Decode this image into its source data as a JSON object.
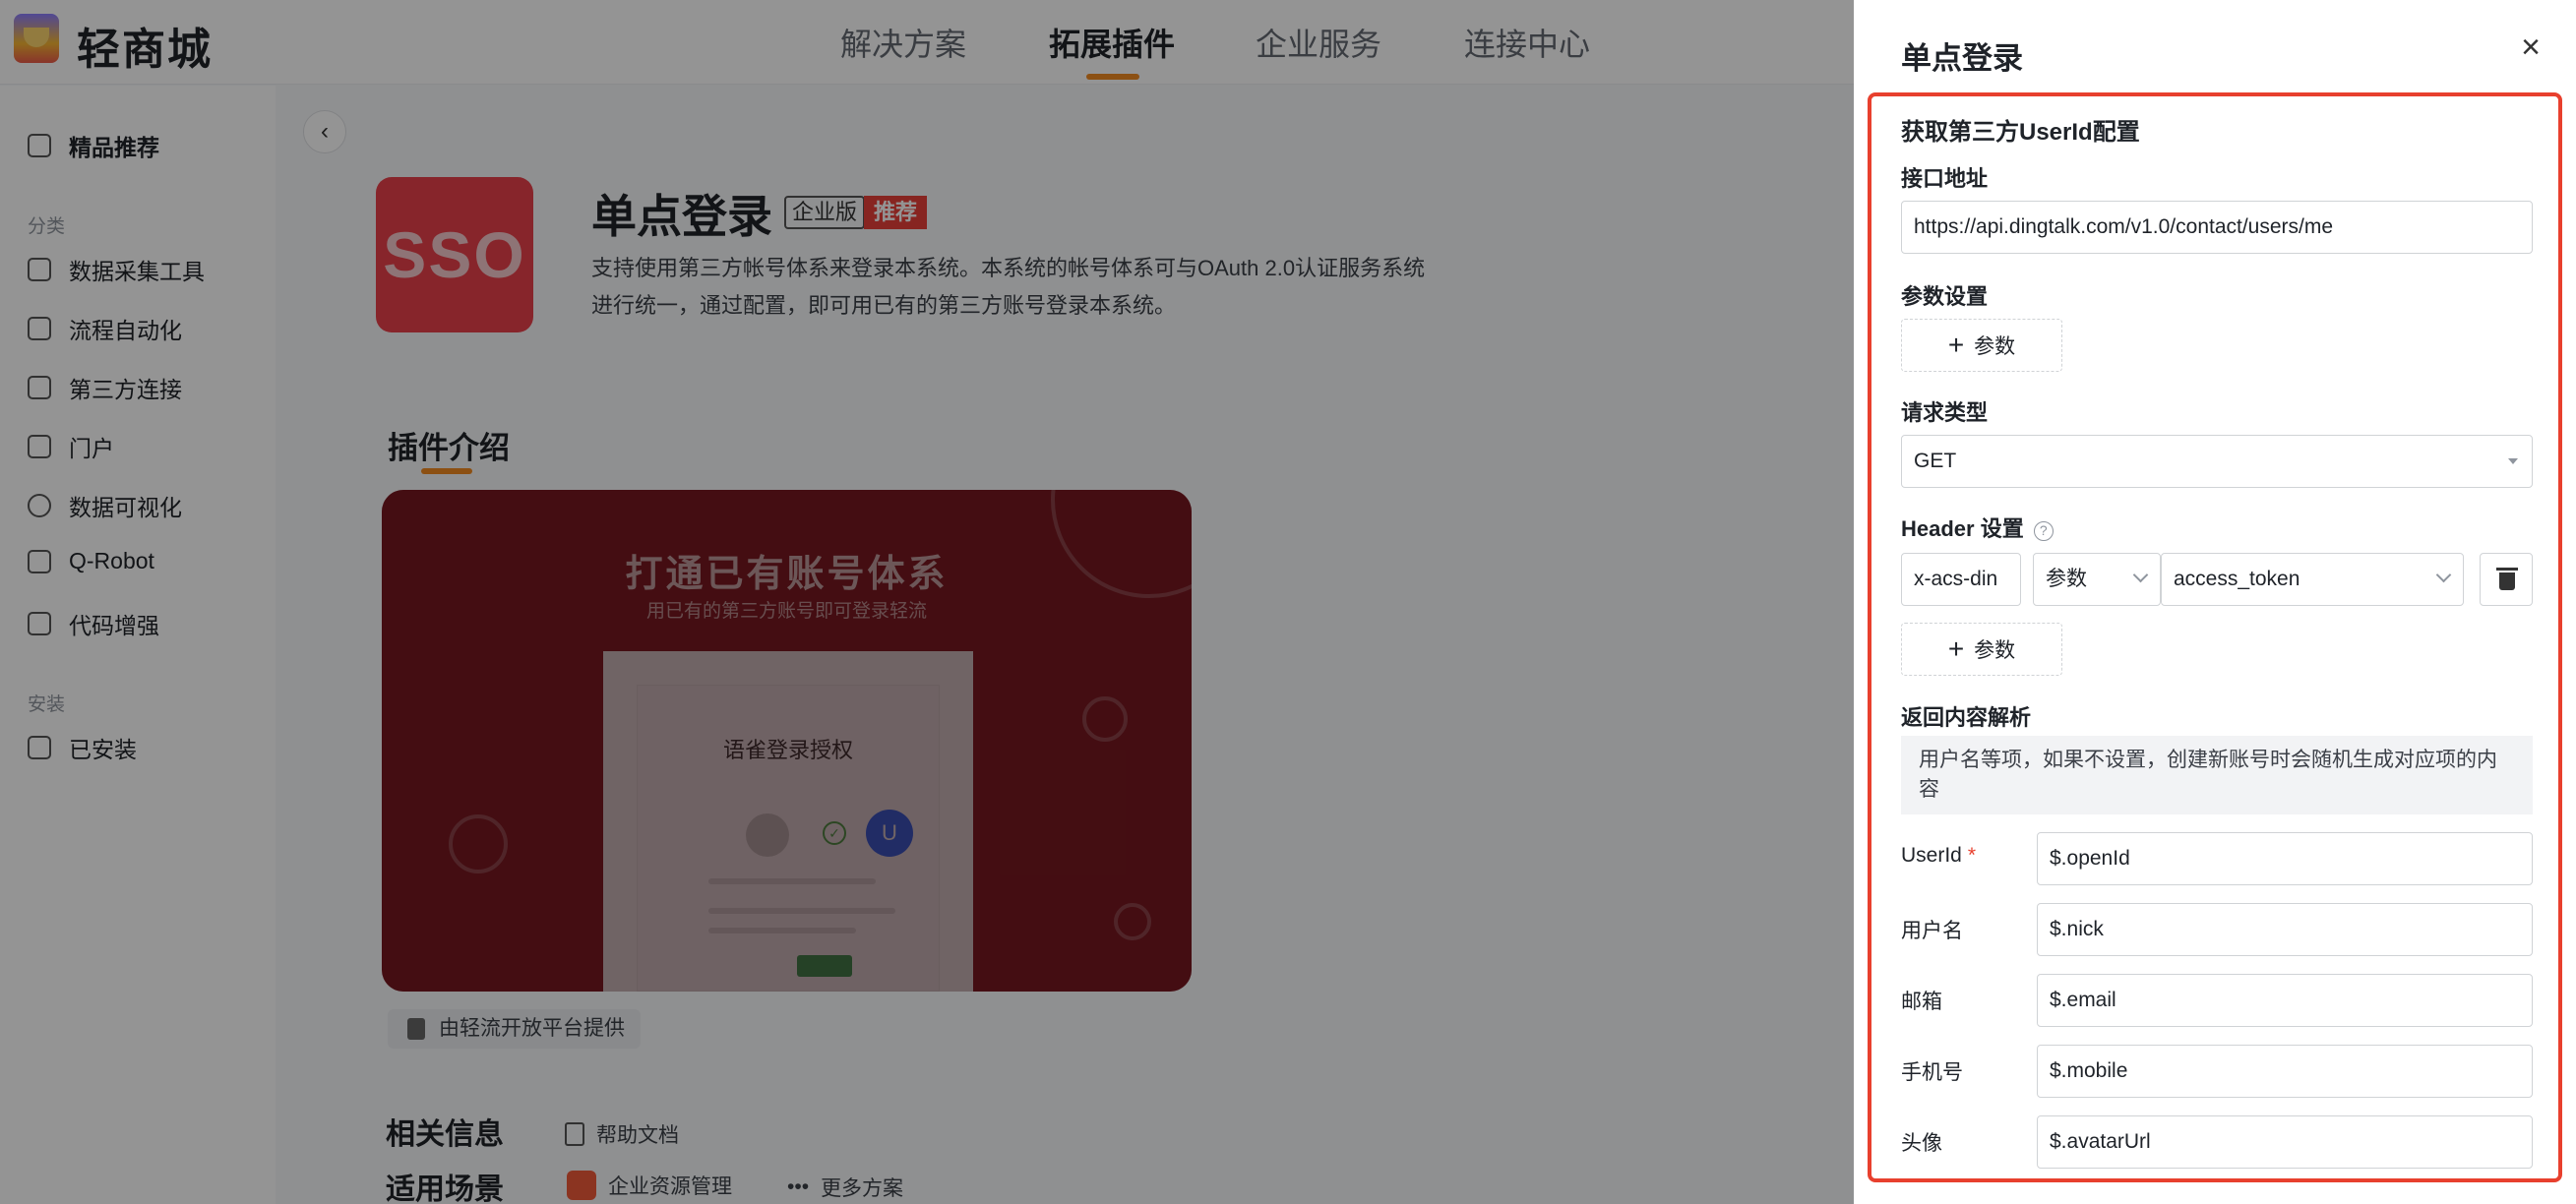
{
  "app": {
    "brand": "轻商城",
    "nav": [
      "解决方案",
      "拓展插件",
      "企业服务",
      "连接中心"
    ],
    "active_nav": "拓展插件"
  },
  "sidebar": {
    "featured": "精品推荐",
    "group_category": "分类",
    "categories": [
      "数据采集工具",
      "流程自动化",
      "第三方连接",
      "门户",
      "数据可视化",
      "Q-Robot",
      "代码增强"
    ],
    "group_install": "安装",
    "installed": "已安装"
  },
  "plugin": {
    "tile_text": "SSO",
    "title": "单点登录",
    "tag_edition": "企业版",
    "tag_recommend": "推荐",
    "description": "支持使用第三方帐号体系来登录本系统。本系统的帐号体系可与OAuth 2.0认证服务系统进行统一，通过配置，即可用已有的第三方账号登录本系统。"
  },
  "intro": {
    "section_title": "插件介绍",
    "banner_title": "打通已有账号体系",
    "banner_subtitle": "用已有的第三方账号即可登录轻流",
    "mock_title": "语雀登录授权",
    "mock_avatar_letter": "U",
    "provider": "由轻流开放平台提供"
  },
  "related": {
    "title": "相关信息",
    "help_doc": "帮助文档",
    "scenario_title": "适用场景",
    "scenario": "企业资源管理",
    "more": "更多方案"
  },
  "drawer": {
    "title": "单点登录",
    "section_heading": "获取第三方UserId配置",
    "api_label": "接口地址",
    "api_value": "https://api.dingtalk.com/v1.0/contact/users/me",
    "params_label": "参数设置",
    "add_param": "参数",
    "method_label": "请求类型",
    "method_value": "GET",
    "header_label": "Header 设置",
    "header_row": {
      "key": "x-acs-din",
      "type": "参数",
      "value": "access_token"
    },
    "parse_label": "返回内容解析",
    "parse_note": "用户名等项，如果不设置，创建新账号时会随机生成对应项的内容",
    "mappings": [
      {
        "label": "UserId",
        "value": "$.openId",
        "required": "*"
      },
      {
        "label": "用户名",
        "value": "$.nick"
      },
      {
        "label": "邮箱",
        "value": "$.email"
      },
      {
        "label": "手机号",
        "value": "$.mobile"
      },
      {
        "label": "头像",
        "value": "$.avatarUrl"
      }
    ]
  },
  "colors": {
    "accent": "#f28a22",
    "highlight": "#e8402e",
    "sso_tile": "#e8404b",
    "banner": "#8a1a23"
  }
}
